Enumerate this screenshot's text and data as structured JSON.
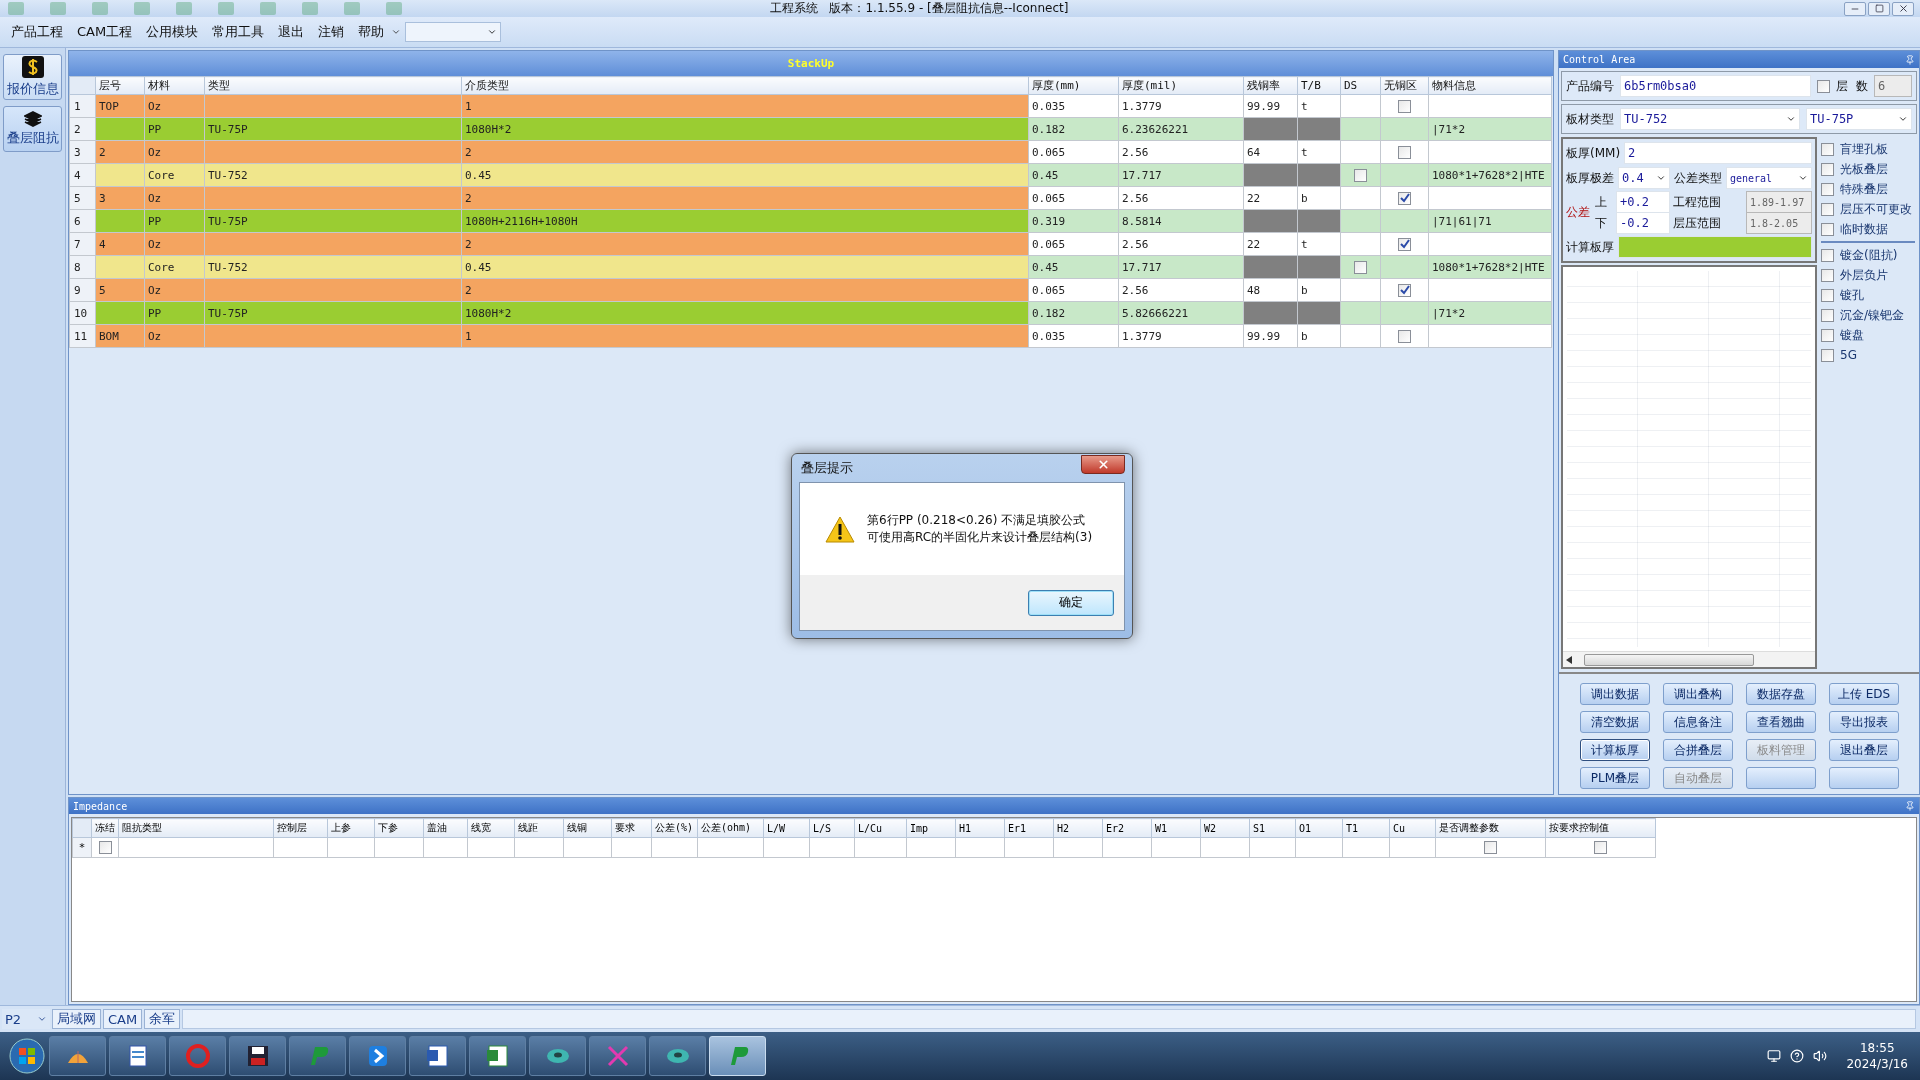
{
  "window": {
    "title": "工程系统   版本：1.1.55.9 - [叠层阻抗信息--Iconnect]"
  },
  "menu": {
    "items": [
      "产品工程",
      "CAM工程",
      "公用模块",
      "常用工具",
      "退出",
      "注销",
      "帮助"
    ]
  },
  "sidebar": {
    "items": [
      {
        "label": "报价信息",
        "kind": "dollar",
        "selected": false
      },
      {
        "label": "叠层阻抗",
        "kind": "layers",
        "selected": true
      }
    ]
  },
  "stackup": {
    "title": "StackUp",
    "columns": [
      "层号",
      "材料",
      "类型",
      "介质类型",
      "厚度(mm)",
      "厚度(mil)",
      "残铜率",
      "T/B",
      "DS",
      "无铜区",
      "物料信息"
    ],
    "rows": [
      {
        "no": "1",
        "kind": "oz",
        "layer": "TOP",
        "material": "Oz",
        "dielectric": "1",
        "mm": "0.035",
        "mil": "1.3779",
        "copper": "99.99",
        "tb": "t",
        "no_copper": false
      },
      {
        "no": "2",
        "kind": "pp",
        "material": "PP",
        "type": "TU-75P",
        "dielectric": "1080H*2",
        "mm": "0.182",
        "mil": "6.23626221",
        "info": "|71*2"
      },
      {
        "no": "3",
        "kind": "oz",
        "layer": "2",
        "material": "Oz",
        "dielectric": "2",
        "mm": "0.065",
        "mil": "2.56",
        "copper": "64",
        "tb": "t",
        "no_copper": false
      },
      {
        "no": "4",
        "kind": "core",
        "material": "Core",
        "type": "TU-752",
        "dielectric": "0.45",
        "mm": "0.45",
        "mil": "17.717",
        "ds": false,
        "info": "1080*1+7628*2|HTE"
      },
      {
        "no": "5",
        "kind": "oz",
        "layer": "3",
        "material": "Oz",
        "dielectric": "2",
        "mm": "0.065",
        "mil": "2.56",
        "copper": "22",
        "tb": "b",
        "no_copper": true
      },
      {
        "no": "6",
        "kind": "pp",
        "material": "PP",
        "type": "TU-75P",
        "dielectric": "1080H+2116H+1080H",
        "mm": "0.319",
        "mil": "8.5814",
        "info": "|71|61|71"
      },
      {
        "no": "7",
        "kind": "oz",
        "layer": "4",
        "material": "Oz",
        "dielectric": "2",
        "mm": "0.065",
        "mil": "2.56",
        "copper": "22",
        "tb": "t",
        "no_copper": true
      },
      {
        "no": "8",
        "kind": "core",
        "material": "Core",
        "type": "TU-752",
        "dielectric": "0.45",
        "mm": "0.45",
        "mil": "17.717",
        "ds": false,
        "info": "1080*1+7628*2|HTE"
      },
      {
        "no": "9",
        "kind": "oz",
        "layer": "5",
        "material": "Oz",
        "dielectric": "2",
        "mm": "0.065",
        "mil": "2.56",
        "copper": "48",
        "tb": "b",
        "no_copper": true
      },
      {
        "no": "10",
        "kind": "pp",
        "material": "PP",
        "type": "TU-75P",
        "dielectric": "1080H*2",
        "mm": "0.182",
        "mil": "5.82666221",
        "info": "|71*2"
      },
      {
        "no": "11",
        "kind": "oz",
        "layer": "BOM",
        "material": "Oz",
        "dielectric": "1",
        "mm": "0.035",
        "mil": "1.3779",
        "copper": "99.99",
        "tb": "b",
        "no_copper": false
      }
    ]
  },
  "dialog": {
    "title": "叠层提示",
    "lines": [
      "第6行PP (0.218<0.26) 不满足填胶公式",
      "可使用高RC的半固化片来设计叠层结构(3)"
    ],
    "ok": "确定"
  },
  "control_area": {
    "title": "Control Area",
    "product": {
      "label": "产品编号",
      "value": "6b5rm0bsa0"
    },
    "layers": {
      "label": "层  数",
      "checked": false,
      "value": "6"
    },
    "board_type": {
      "label": "板材类型",
      "value": "TU-752",
      "value2": "TU-75P"
    },
    "thickness": {
      "label": "板厚(MM)",
      "value": "2"
    },
    "thick_tol": {
      "label": "板厚极差",
      "value": "0.4"
    },
    "tol_type": {
      "label": "公差类型",
      "value": "general"
    },
    "tol_label": "公差",
    "upper": {
      "label": "上",
      "value": "+0.2"
    },
    "lower": {
      "label": "下",
      "value": "-0.2"
    },
    "eng_range": {
      "label": "工程范围",
      "value": "1.89-1.97"
    },
    "press_range": {
      "label": "层压范围",
      "value": "1.8-2.05"
    },
    "calc": {
      "label": "计算板厚"
    },
    "options": [
      {
        "label": "盲埋孔板",
        "checked": false
      },
      {
        "label": "光板叠层",
        "checked": false
      },
      {
        "label": "特殊叠层",
        "checked": false
      },
      {
        "label": "层压不可更改",
        "checked": false
      },
      {
        "label": "临时数据",
        "checked": false
      }
    ],
    "options2": [
      {
        "label": "镀金(阻抗)",
        "checked": false
      },
      {
        "label": "外层负片",
        "checked": false
      },
      {
        "label": "镀孔",
        "checked": false
      },
      {
        "label": "沉金/镍钯金",
        "checked": false
      },
      {
        "label": "镀盘",
        "checked": false
      },
      {
        "label": "5G",
        "checked": false
      }
    ],
    "buttons": [
      {
        "label": "调出数据",
        "disabled": false,
        "focused": false
      },
      {
        "label": "调出叠构",
        "disabled": false,
        "focused": false
      },
      {
        "label": "数据存盘",
        "disabled": false,
        "focused": false
      },
      {
        "label": "上传 EDS",
        "disabled": false,
        "focused": false
      },
      {
        "label": "清空数据",
        "disabled": false,
        "focused": false
      },
      {
        "label": "信息备注",
        "disabled": false,
        "focused": false
      },
      {
        "label": "查看翘曲",
        "disabled": false,
        "focused": false
      },
      {
        "label": "导出报表",
        "disabled": false,
        "focused": false
      },
      {
        "label": "计算板厚",
        "disabled": false,
        "focused": true
      },
      {
        "label": "合拼叠层",
        "disabled": false,
        "focused": false
      },
      {
        "label": "板料管理",
        "disabled": true,
        "focused": false
      },
      {
        "label": "退出叠层",
        "disabled": false,
        "focused": false
      },
      {
        "label": "PLM叠层",
        "disabled": false,
        "focused": false
      },
      {
        "label": "自动叠层",
        "disabled": true,
        "focused": false
      },
      {
        "disabled": false,
        "focused": false
      },
      {
        "disabled": false,
        "focused": false
      }
    ]
  },
  "impedance": {
    "title": "Impedance",
    "columns": [
      {
        "label": "冻结",
        "kind": "check"
      },
      {
        "label": "阻抗类型",
        "kind": "text"
      },
      {
        "label": "控制层",
        "kind": "text"
      },
      {
        "label": "上参",
        "kind": "text"
      },
      {
        "label": "下参",
        "kind": "text"
      },
      {
        "label": "盖油",
        "kind": "text"
      },
      {
        "label": "线宽",
        "kind": "text"
      },
      {
        "label": "线距",
        "kind": "text"
      },
      {
        "label": "线铜",
        "kind": "text"
      },
      {
        "label": "要求",
        "kind": "text"
      },
      {
        "label": "公差(%)",
        "kind": "text"
      },
      {
        "label": "公差(ohm)",
        "kind": "text"
      },
      {
        "label": "L/W",
        "kind": "text"
      },
      {
        "label": "L/S",
        "kind": "text"
      },
      {
        "label": "L/Cu",
        "kind": "text"
      },
      {
        "label": "Imp",
        "kind": "text"
      },
      {
        "label": "H1",
        "kind": "text"
      },
      {
        "label": "Er1",
        "kind": "text"
      },
      {
        "label": "H2",
        "kind": "text"
      },
      {
        "label": "Er2",
        "kind": "text"
      },
      {
        "label": "W1",
        "kind": "text"
      },
      {
        "label": "W2",
        "kind": "text"
      },
      {
        "label": "S1",
        "kind": "text"
      },
      {
        "label": "O1",
        "kind": "text"
      },
      {
        "label": "T1",
        "kind": "text"
      },
      {
        "label": "Cu",
        "kind": "text"
      },
      {
        "label": "是否调整参数",
        "kind": "check"
      },
      {
        "label": "按要求控制值",
        "kind": "check"
      }
    ],
    "new_row": {
      "marker": "*",
      "checks": [
        false,
        false,
        false
      ]
    }
  },
  "status_bar": {
    "combo": "P2",
    "tabs": [
      {
        "label": "局域网",
        "selected": false
      },
      {
        "label": "CAM",
        "selected": false
      },
      {
        "label": "余军",
        "selected": false
      }
    ]
  },
  "taskbar": {
    "apps": [
      {
        "kind": "shell",
        "selected": false
      },
      {
        "kind": "notepad",
        "selected": false
      },
      {
        "kind": "swirl",
        "selected": false
      },
      {
        "kind": "save",
        "selected": false
      },
      {
        "kind": "p",
        "selected": false
      },
      {
        "kind": "arrow",
        "selected": false
      },
      {
        "kind": "word",
        "selected": false
      },
      {
        "kind": "excel",
        "selected": false
      },
      {
        "kind": "disc",
        "selected": false
      },
      {
        "kind": "cross",
        "selected": false
      },
      {
        "kind": "disc",
        "selected": false
      },
      {
        "kind": "p",
        "selected": true
      }
    ],
    "time": "18:55",
    "date": "2024/3/16"
  }
}
